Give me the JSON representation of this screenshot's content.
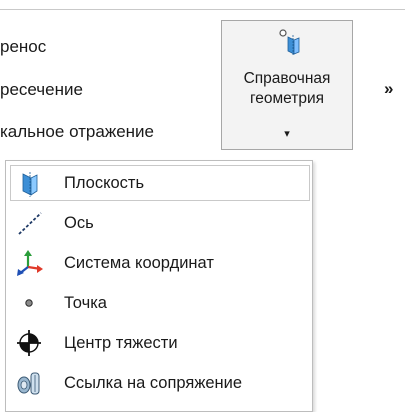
{
  "ribbon": {
    "menu_items": [
      {
        "label": "ренос"
      },
      {
        "label": "ресечение"
      },
      {
        "label": "кальное отражение"
      }
    ],
    "ref_geometry_button": {
      "label_line1": "Справочная",
      "label_line2": "геометрия",
      "caret": "▾",
      "icon": "reference-geometry-icon"
    },
    "overflow": {
      "label": "»"
    }
  },
  "dropdown": {
    "items": [
      {
        "label": "Плоскость",
        "icon": "plane-icon"
      },
      {
        "label": "Ось",
        "icon": "axis-icon"
      },
      {
        "label": "Система координат",
        "icon": "coordinate-system-icon"
      },
      {
        "label": "Точка",
        "icon": "point-icon"
      },
      {
        "label": "Центр тяжести",
        "icon": "center-of-mass-icon"
      },
      {
        "label": "Ссылка на сопряжение",
        "icon": "mate-reference-icon"
      }
    ]
  },
  "colors": {
    "plane_blue": "#3d8fd6",
    "axis_navy": "#1f3a66",
    "coord_red": "#e03a2a",
    "coord_green": "#2a9d3a",
    "coord_blue": "#1f4fb5"
  }
}
